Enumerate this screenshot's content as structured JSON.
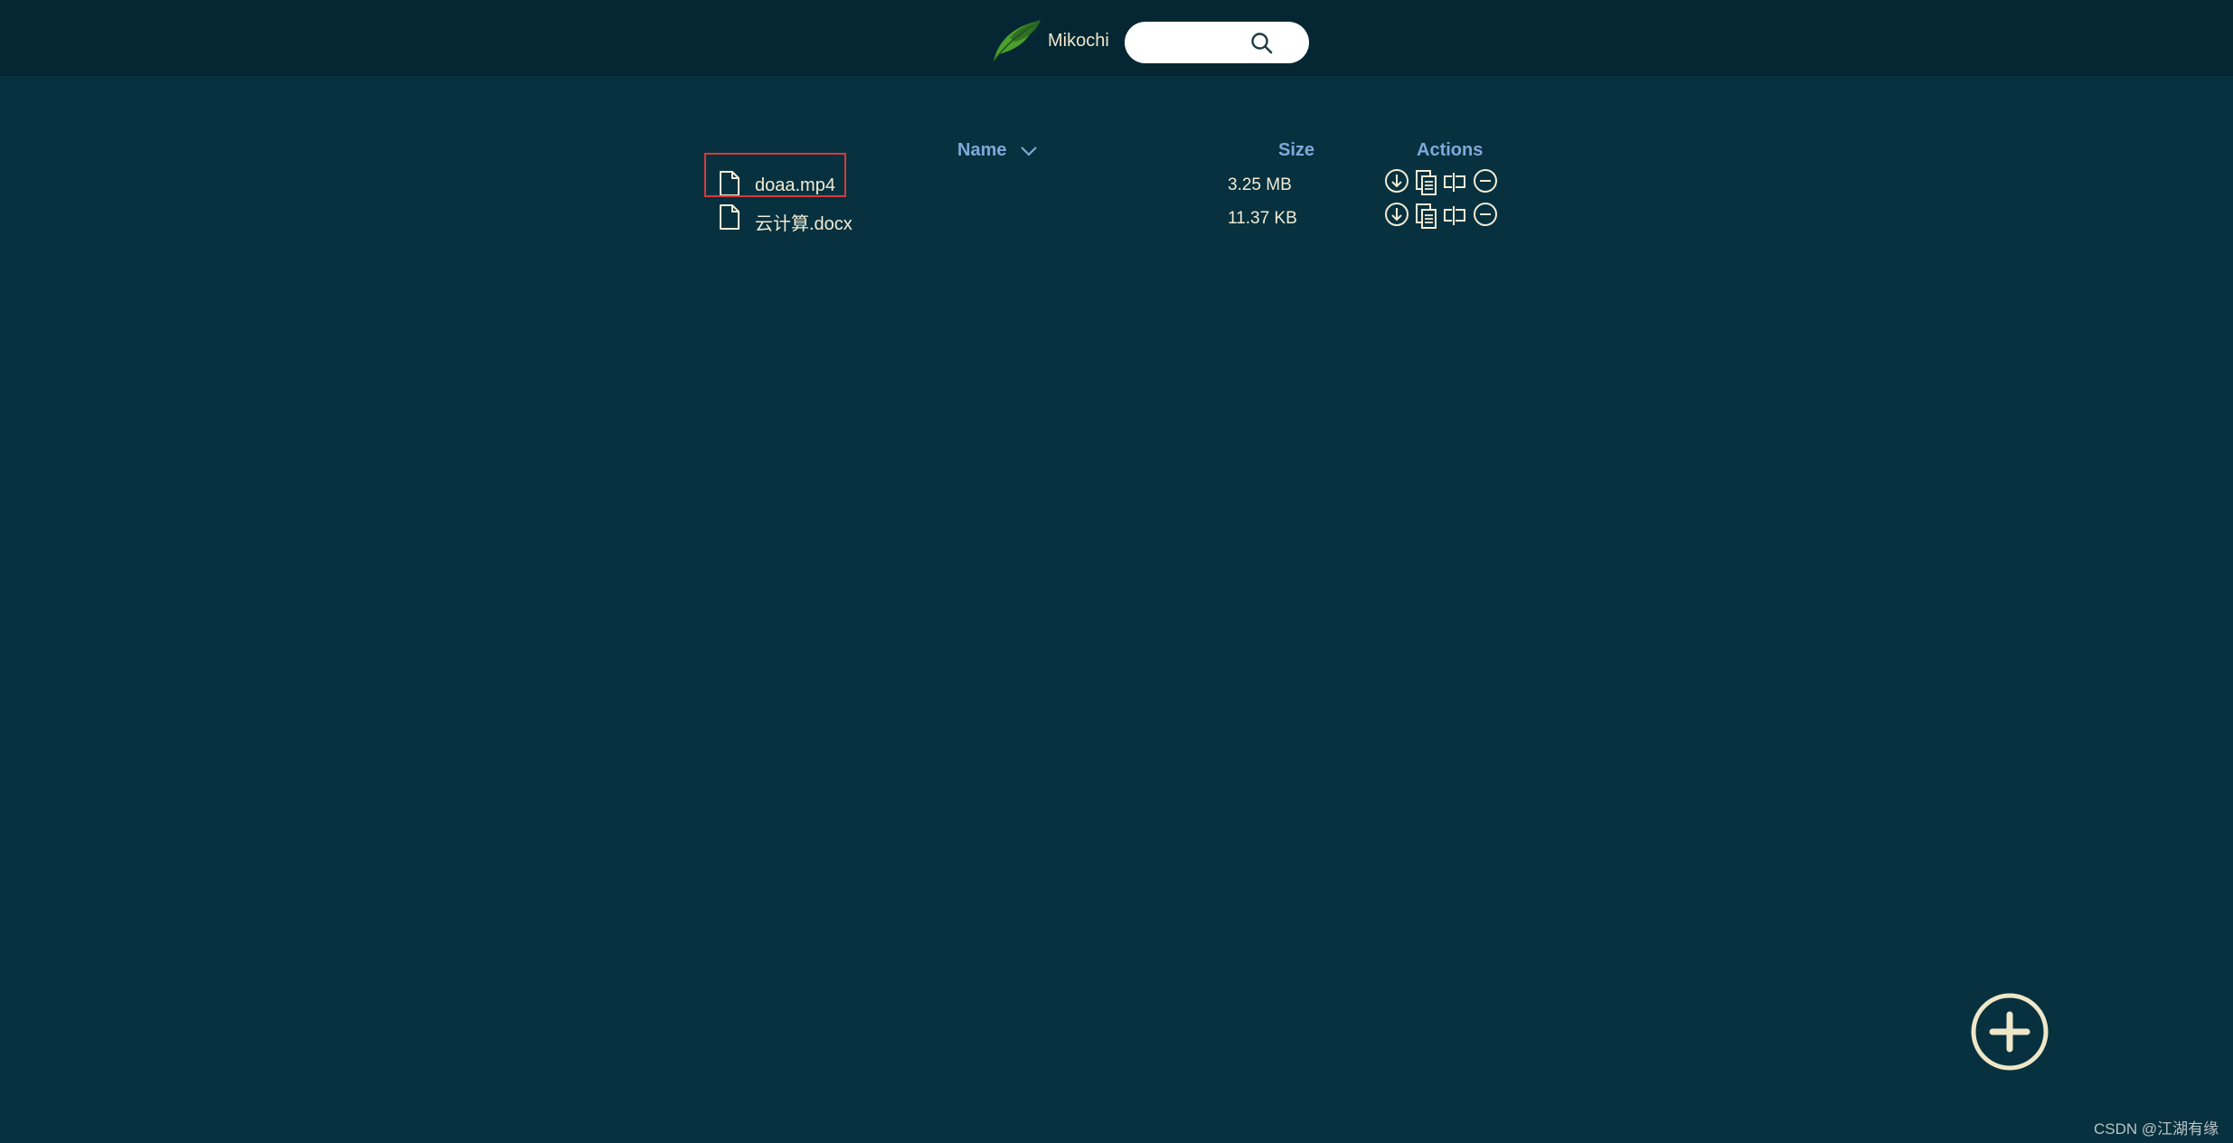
{
  "header": {
    "app_name": "Mikochi",
    "search": {
      "placeholder": "",
      "value": ""
    }
  },
  "table": {
    "columns": {
      "name": "Name",
      "size": "Size",
      "actions": "Actions"
    },
    "sort": {
      "column": "Name",
      "direction": "descending"
    },
    "rows": [
      {
        "name": "doaa.mp4",
        "size": "3.25 MB",
        "highlighted": true
      },
      {
        "name": "云计算.docx",
        "size": "11.37 KB",
        "highlighted": false
      }
    ],
    "row_actions": [
      "download-icon",
      "copy-icon",
      "rename-icon",
      "delete-icon"
    ]
  },
  "fab": {
    "icon": "plus-circle-icon"
  },
  "watermark": "CSDN @江湖有缘",
  "colors": {
    "background": "#07313f",
    "header": "#042733",
    "accent_text": "#7fa9d9",
    "text": "#f3ecd5",
    "highlight": "#d8393a",
    "leaf_green": "#4aa02c"
  }
}
